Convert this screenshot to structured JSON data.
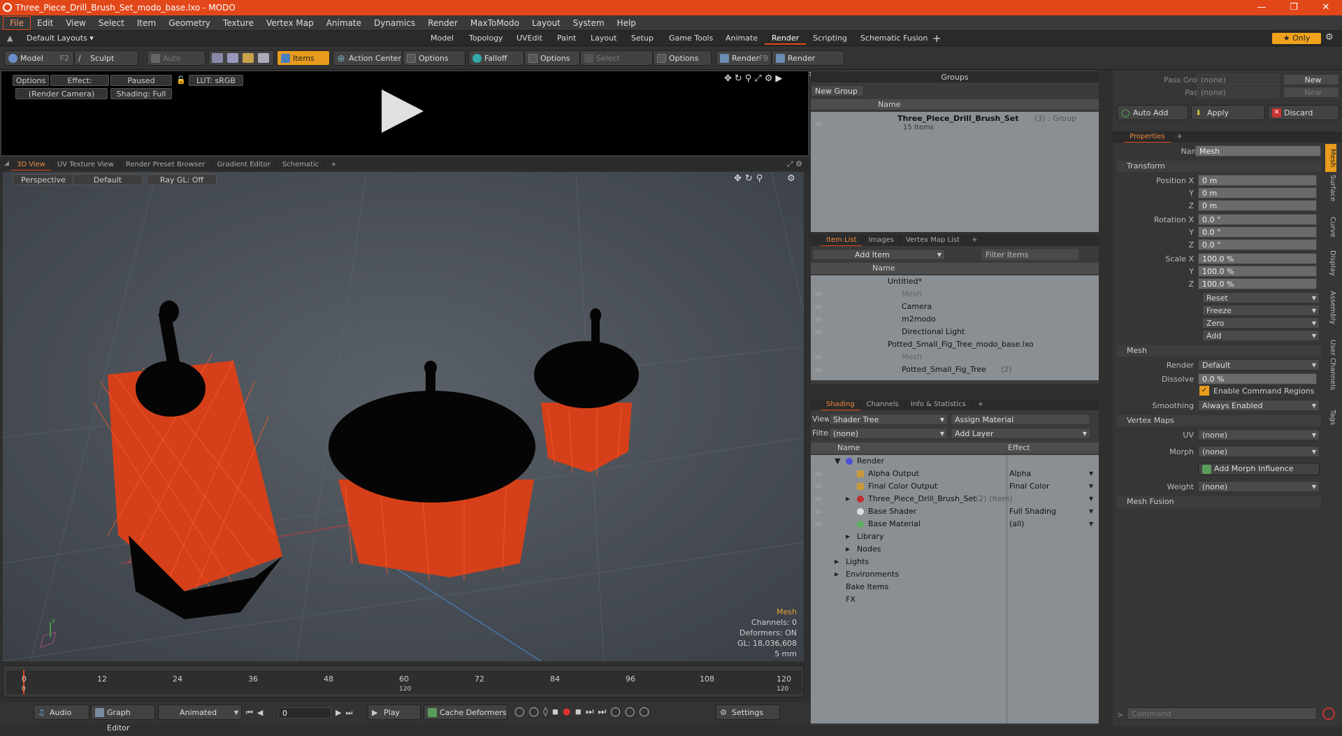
{
  "app": {
    "title": "Three_Piece_Drill_Brush_Set_modo_base.lxo - MODO",
    "window_buttons": [
      "—",
      "❐",
      "✕"
    ]
  },
  "menu": [
    "File",
    "Edit",
    "View",
    "Select",
    "Item",
    "Geometry",
    "Texture",
    "Vertex Map",
    "Animate",
    "Dynamics",
    "Render",
    "MaxToModo",
    "Layout",
    "System",
    "Help"
  ],
  "layout_bar": {
    "default_layouts": "Default Layouts ▾",
    "tabs": [
      "Model",
      "Topology",
      "UVEdit",
      "Paint",
      "Layout",
      "Setup",
      "Game Tools",
      "Animate",
      "Render",
      "Scripting",
      "Schematic Fusion"
    ],
    "active_tab": "Render",
    "add": "+",
    "only": "★ Only"
  },
  "toolbar": {
    "model": "Model",
    "model_key": "F2",
    "sculpt": "Sculpt",
    "auto_select": "Auto Select",
    "items": "Items",
    "action_center": "Action Center",
    "options1": "Options",
    "falloff": "Falloff",
    "options2": "Options",
    "select_through": "Select Through",
    "options3": "Options",
    "render": "Render",
    "render_key": "F9",
    "render_window": "Render Window"
  },
  "render_preview": {
    "options": "Options",
    "effect": "Effect: (Shadi...",
    "paused": "Paused",
    "lut": "LUT: sRGB",
    "camera": "(Render Camera)",
    "shading": "Shading: Full"
  },
  "viewport": {
    "tabs": [
      "3D View",
      "UV Texture View",
      "Render Preset Browser",
      "Gradient Editor",
      "Schematic"
    ],
    "perspective": "Perspective",
    "default": "Default",
    "raygl": "Ray GL: Off",
    "info_title": "Mesh",
    "info_lines": [
      "Channels: 0",
      "Deformers: ON",
      "GL: 18,036,608",
      "5 mm"
    ]
  },
  "timeline": {
    "ticks": [
      "0",
      "12",
      "24",
      "36",
      "48",
      "60",
      "72",
      "84",
      "96",
      "108",
      "120"
    ],
    "sub_ticks": [
      "0",
      "120",
      "120"
    ]
  },
  "bottombar": {
    "audio": "Audio",
    "graph_editor": "Graph Editor",
    "animated": "Animated",
    "frame": "0",
    "play": "Play",
    "cache_deformers": "Cache Deformers",
    "settings": "Settings"
  },
  "groups": {
    "title": "Groups",
    "new_group": "New Group",
    "col_name": "Name",
    "item_name": "Three_Piece_Drill_Brush_Set",
    "item_suffix": "(3) : Group",
    "item_sub": "15 Items"
  },
  "itemlist": {
    "tabs": [
      "Item List",
      "Images",
      "Vertex Map List"
    ],
    "add_item": "Add Item",
    "filter_items": "Filter Items",
    "col_name": "Name",
    "rows": [
      {
        "label": "Untitled*",
        "dim": false
      },
      {
        "label": "Mesh",
        "dim": true
      },
      {
        "label": "Camera",
        "dim": false
      },
      {
        "label": "m2modo",
        "dim": false
      },
      {
        "label": "Directional Light",
        "dim": false
      },
      {
        "label": "Potted_Small_Fig_Tree_modo_base.lxo",
        "dim": false
      },
      {
        "label": "Mesh",
        "dim": true
      },
      {
        "label": "Potted_Small_Fig_Tree",
        "dim": false
      }
    ],
    "row8_suffix": "(2)"
  },
  "shading": {
    "tabs": [
      "Shading",
      "Channels",
      "Info & Statistics"
    ],
    "view_label": "View",
    "view_value": "Shader Tree",
    "assign_material": "Assign Material",
    "filter_label": "Filter",
    "filter_value": "(none)",
    "add_layer": "Add Layer",
    "col_name": "Name",
    "col_effect": "Effect",
    "rows": [
      {
        "name": "Render",
        "effect": ""
      },
      {
        "name": "Alpha Output",
        "effect": "Alpha"
      },
      {
        "name": "Final Color Output",
        "effect": "Final Color"
      },
      {
        "name": "Three_Piece_Drill_Brush_Set",
        "effect": ""
      },
      {
        "name": "Base Shader",
        "effect": "Full Shading"
      },
      {
        "name": "Base Material",
        "effect": "(all)"
      },
      {
        "name": "Library",
        "effect": ""
      },
      {
        "name": "Nodes",
        "effect": ""
      },
      {
        "name": "Lights",
        "effect": ""
      },
      {
        "name": "Environments",
        "effect": ""
      },
      {
        "name": "Bake Items",
        "effect": ""
      },
      {
        "name": "FX",
        "effect": ""
      }
    ],
    "row4_suffix": "(2) (Item)"
  },
  "passes": {
    "pass_groups_label": "Pass Groups",
    "pass_groups_value": "(none)",
    "passes_label": "Passes",
    "passes_value": "(none)",
    "new1": "New",
    "new2": "New",
    "auto_add": "Auto Add",
    "apply": "Apply",
    "discard": "Discard"
  },
  "properties": {
    "tab": "Properties",
    "name_label": "Name",
    "name_value": "Mesh",
    "transform": "Transform",
    "position_label": "Position X",
    "rotation_label": "Rotation X",
    "scale_label": "Scale X",
    "y": "Y",
    "z": "Z",
    "pos": [
      "0 m",
      "0 m",
      "0 m"
    ],
    "rot": [
      "0.0 °",
      "0.0 °",
      "0.0 °"
    ],
    "scl": [
      "100.0 %",
      "100.0 %",
      "100.0 %"
    ],
    "reset": "Reset",
    "freeze": "Freeze",
    "zero": "Zero",
    "add": "Add",
    "mesh": "Mesh",
    "render_label": "Render",
    "render_value": "Default",
    "dissolve_label": "Dissolve",
    "dissolve_value": "0.0 %",
    "enable_command_regions": "Enable Command Regions",
    "smoothing_label": "Smoothing",
    "smoothing_value": "Always Enabled",
    "vertex_maps": "Vertex Maps",
    "uv_label": "UV",
    "uv_value": "(none)",
    "morph_label": "Morph",
    "morph_value": "(none)",
    "add_morph": "Add Morph Influence",
    "weight_label": "Weight",
    "weight_value": "(none)",
    "mesh_fusion": "Mesh Fusion",
    "side_tabs": [
      "Mesh",
      "Surface",
      "Curve",
      "Display",
      "Assembly",
      "User Channels",
      "Tags"
    ],
    "command_placeholder": "Command"
  }
}
